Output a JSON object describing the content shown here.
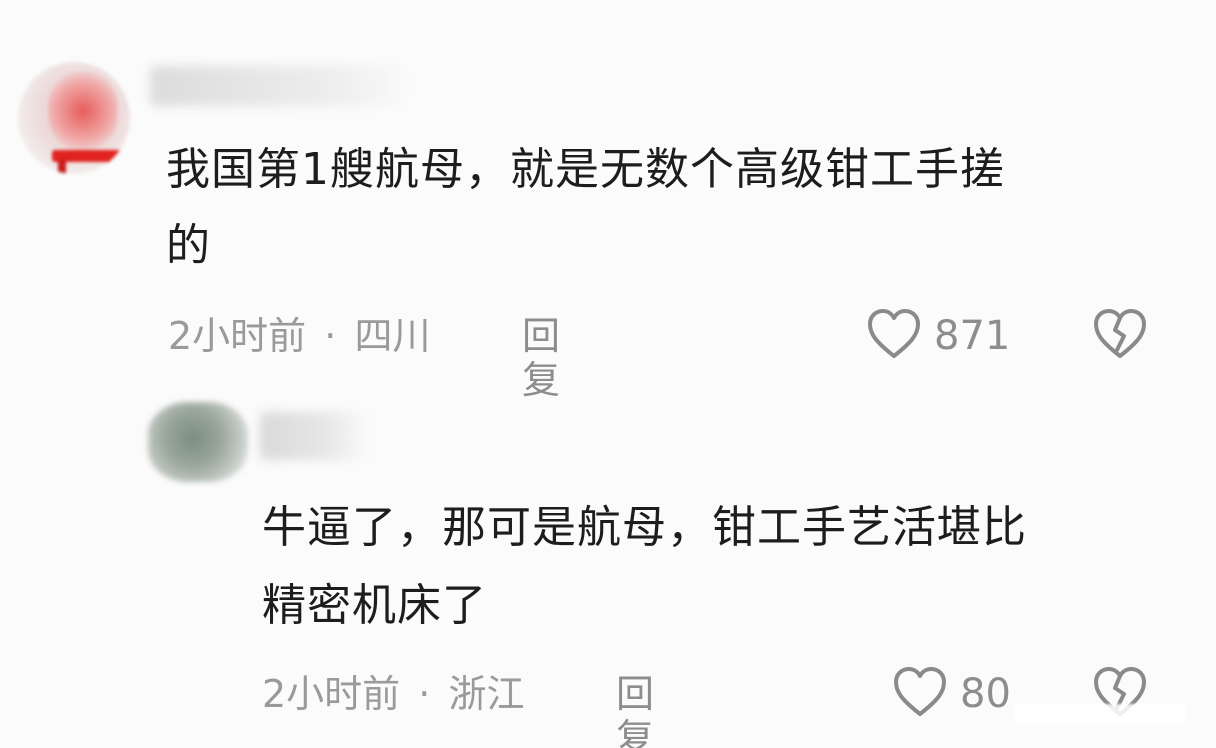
{
  "comments": [
    {
      "text_line1": "我国第1艘航母，就是无数个高级钳工手搓",
      "text_line2": "的",
      "time": "2小时前",
      "separator": "·",
      "location": "四川",
      "reply_label": "回复",
      "likes": "871"
    },
    {
      "text_line1": "牛逼了，那可是航母，钳工手艺活堪比",
      "text_line2": "精密机床了",
      "time": "2小时前",
      "separator": "·",
      "location": "浙江",
      "reply_label": "回复",
      "likes": "80"
    }
  ],
  "icons": {
    "like": "heart-outline-icon",
    "dislike": "broken-heart-outline-icon"
  }
}
